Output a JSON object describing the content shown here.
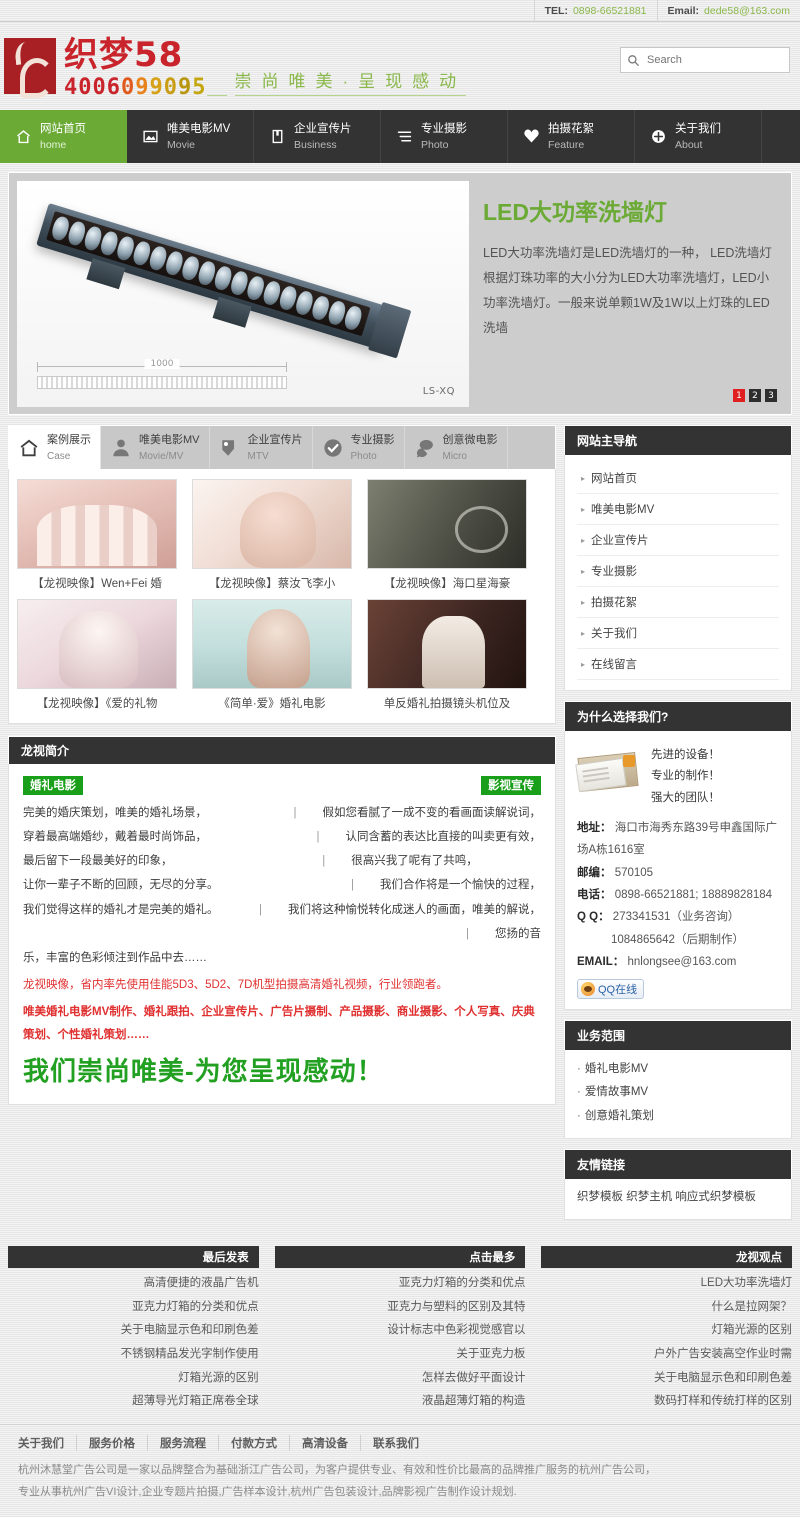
{
  "topbar": {
    "tel_label": "TEL:",
    "tel_value": "0898-66521881",
    "email_label": "Email:",
    "email_value": "dede58@163.com"
  },
  "header": {
    "logo_name": "织梦58",
    "logo_phone": "4006099095",
    "slogan": "崇尚唯美·呈现感动",
    "search_placeholder": "Search",
    "search_value": ""
  },
  "mainnav": [
    {
      "cn": "网站首页",
      "en": "home",
      "icon": "home-icon",
      "active": true
    },
    {
      "cn": "唯美电影MV",
      "en": "Movie",
      "icon": "image-icon",
      "active": false
    },
    {
      "cn": "企业宣传片",
      "en": "Business",
      "icon": "book-icon",
      "active": false
    },
    {
      "cn": "专业摄影",
      "en": "Photo",
      "icon": "lines-icon",
      "active": false
    },
    {
      "cn": "拍摄花絮",
      "en": "Feature",
      "icon": "heart-icon",
      "active": false
    },
    {
      "cn": "关于我们",
      "en": "About",
      "icon": "plus-circle-icon",
      "active": false
    }
  ],
  "banner": {
    "title": "LED大功率洗墙灯",
    "desc": "LED大功率洗墙灯是LED洗墙灯的一种， LED洗墙灯根据灯珠功率的大小分为LED大功率洗墙灯，LED小功率洗墙灯。一般来说单颗1W及1W以上灯珠的LED洗墙",
    "image_dimension": "1000",
    "image_model": "LS-XQ",
    "dots": [
      "1",
      "2",
      "3"
    ],
    "active_dot": 0
  },
  "tabs": [
    {
      "cn": "案例展示",
      "en": "Case",
      "icon": "home-icon",
      "active": true
    },
    {
      "cn": "唯美电影MV",
      "en": "Movie/MV",
      "icon": "person-icon",
      "active": false
    },
    {
      "cn": "企业宣传片",
      "en": "MTV",
      "icon": "pin-icon",
      "active": false
    },
    {
      "cn": "专业摄影",
      "en": "Photo",
      "icon": "check-circle-icon",
      "active": false
    },
    {
      "cn": "创意微电影",
      "en": "Micro",
      "icon": "chat-icon",
      "active": false
    }
  ],
  "gallery": [
    {
      "caption": "【龙视映像】Wen+Fei 婚"
    },
    {
      "caption": "【龙视映像】蔡汝飞李小"
    },
    {
      "caption": "【龙视映像】海口星海豪"
    },
    {
      "caption": "【龙视映像】《爱的礼物"
    },
    {
      "caption": "《简单·爱》婚礼电影"
    },
    {
      "caption": "单反婚礼拍摄镜头机位及"
    }
  ],
  "intro": {
    "heading": "龙视简介",
    "tag_left": "婚礼电影",
    "tag_right": "影视宣传",
    "left_lines": [
      "完美的婚庆策划，唯美的婚礼场景，",
      "穿着最高端婚纱，戴着最时尚饰品，",
      "最后留下一段最美好的印象，",
      "让你一辈子不断的回顾，无尽的分享。",
      "我们觉得这样的婚礼才是完美的婚礼。"
    ],
    "right_lines": [
      "假如您看腻了一成不变的看画面读解说词，",
      "认同含蓄的表达比直接的叫卖更有效，",
      "很高兴我了呢有了共鸣，",
      "我们合作将是一个愉快的过程，",
      "我们将这种愉悦转化成迷人的画面，唯美的解说，",
      "您扬的音"
    ],
    "tail_line": "乐，丰富的色彩倾注到作品中去……",
    "red_line": "龙视映像，省内率先使用佳能5D3、5D2、7D机型拍摄高清婚礼视频，行业领跑者。",
    "red_bold_line": "唯美婚礼电影MV制作、婚礼跟拍、企业宣传片、广告片摄制、产品摄影、商业摄影、个人写真、庆典策划、个性婚礼策划……",
    "big_line": "我们崇尚唯美-为您呈现感动！"
  },
  "sidebar": {
    "nav_title": "网站主导航",
    "nav_items": [
      "网站首页",
      "唯美电影MV",
      "企业宣传片",
      "专业摄影",
      "拍摄花絮",
      "关于我们",
      "在线留言"
    ],
    "why_title": "为什么选择我们?",
    "why_lines": [
      "先进的设备！",
      "专业的制作！",
      "强大的团队！"
    ],
    "info": [
      {
        "k": "地址：",
        "v": "海口市海秀东路39号申鑫国际广场A栋1616室"
      },
      {
        "k": "邮编：",
        "v": "570105"
      },
      {
        "k": "电话：",
        "v": "0898-66521881; 18889828184"
      },
      {
        "k": "Q Q：",
        "v": "273341531（业务咨询）"
      },
      {
        "k": "",
        "v": "1084865642（后期制作）"
      },
      {
        "k": "EMAIL：",
        "v": "hnlongsee@163.com"
      }
    ],
    "qq_label": "QQ在线",
    "biz_title": "业务范围",
    "biz_items": [
      "婚礼电影MV",
      "爱情故事MV",
      "创意婚礼策划"
    ],
    "links_title": "友情链接",
    "links_text": "织梦模板 织梦主机 响应式织梦模板"
  },
  "bottom_columns": [
    {
      "title": "最后发表",
      "items": [
        "高清便捷的液晶广告机",
        "亚克力灯箱的分类和优点",
        "关于电脑显示色和印刷色差",
        "不锈钢精品发光字制作使用",
        "灯箱光源的区别",
        "超薄导光灯箱正席卷全球"
      ]
    },
    {
      "title": "点击最多",
      "items": [
        "亚克力灯箱的分类和优点",
        "亚克力与塑料的区别及其特",
        "设计标志中色彩视觉感官以",
        "关于亚克力板",
        "怎样去做好平面设计",
        "液晶超薄灯箱的构造"
      ]
    },
    {
      "title": "龙视观点",
      "items": [
        "LED大功率洗墙灯",
        "什么是拉网架？",
        "灯箱光源的区别",
        "户外广告安装高空作业时需",
        "关于电脑显示色和印刷色差",
        "数码打样和传统打样的区别"
      ]
    }
  ],
  "footer": {
    "links": [
      "关于我们",
      "服务价格",
      "服务流程",
      "付款方式",
      "高清设备",
      "联系我们"
    ],
    "paragraph1": "杭州沐慧堂广告公司是一家以品牌整合为基础浙江广告公司，为客户提供专业、有效和性价比最高的品牌推广服务的杭州广告公司，",
    "paragraph2": "专业从事杭州广告VI设计,企业专题片拍摄,广告样本设计,杭州广告包装设计,品牌影视广告制作设计规划."
  },
  "colors": {
    "accent_green": "#6aaa35",
    "brand_red": "#c9242b",
    "dark_bar": "#333333"
  }
}
